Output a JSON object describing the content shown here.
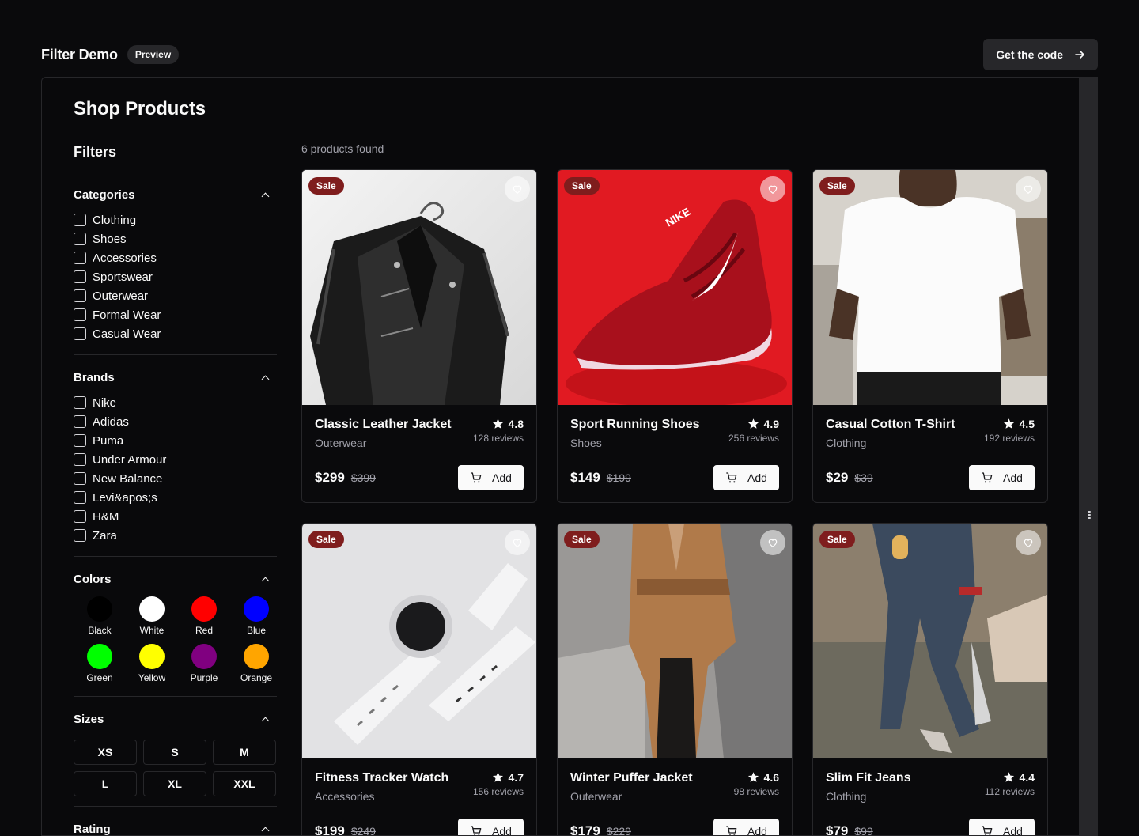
{
  "topbar": {
    "title": "Filter Demo",
    "badge": "Preview",
    "cta": "Get the code"
  },
  "page": {
    "title": "Shop Products",
    "filters_heading": "Filters",
    "count_text": "6 products found"
  },
  "filters": {
    "categories": {
      "title": "Categories",
      "items": [
        "Clothing",
        "Shoes",
        "Accessories",
        "Sportswear",
        "Outerwear",
        "Formal Wear",
        "Casual Wear"
      ]
    },
    "brands": {
      "title": "Brands",
      "items": [
        "Nike",
        "Adidas",
        "Puma",
        "Under Armour",
        "New Balance",
        "Levi&apos;s",
        "H&M",
        "Zara"
      ]
    },
    "colors": {
      "title": "Colors",
      "items": [
        {
          "label": "Black",
          "hex": "#000000"
        },
        {
          "label": "White",
          "hex": "#ffffff"
        },
        {
          "label": "Red",
          "hex": "#ff0000"
        },
        {
          "label": "Blue",
          "hex": "#0000ff"
        },
        {
          "label": "Green",
          "hex": "#00ff00"
        },
        {
          "label": "Yellow",
          "hex": "#ffff00"
        },
        {
          "label": "Purple",
          "hex": "#800080"
        },
        {
          "label": "Orange",
          "hex": "#ffa500"
        }
      ]
    },
    "sizes": {
      "title": "Sizes",
      "items": [
        "XS",
        "S",
        "M",
        "L",
        "XL",
        "XXL"
      ]
    },
    "rating": {
      "title": "Rating"
    }
  },
  "products": [
    {
      "name": "Classic Leather Jacket",
      "category": "Outerwear",
      "rating": "4.8",
      "reviews": "128 reviews",
      "price": "$299",
      "old_price": "$399",
      "badge": "Sale",
      "add": "Add"
    },
    {
      "name": "Sport Running Shoes",
      "category": "Shoes",
      "rating": "4.9",
      "reviews": "256 reviews",
      "price": "$149",
      "old_price": "$199",
      "badge": "Sale",
      "add": "Add"
    },
    {
      "name": "Casual Cotton T-Shirt",
      "category": "Clothing",
      "rating": "4.5",
      "reviews": "192 reviews",
      "price": "$29",
      "old_price": "$39",
      "badge": "Sale",
      "add": "Add"
    },
    {
      "name": "Fitness Tracker Watch",
      "category": "Accessories",
      "rating": "4.7",
      "reviews": "156 reviews",
      "price": "$199",
      "old_price": "$249",
      "badge": "Sale",
      "add": "Add"
    },
    {
      "name": "Winter Puffer Jacket",
      "category": "Outerwear",
      "rating": "4.6",
      "reviews": "98 reviews",
      "price": "$179",
      "old_price": "$229",
      "badge": "Sale",
      "add": "Add"
    },
    {
      "name": "Slim Fit Jeans",
      "category": "Clothing",
      "rating": "4.4",
      "reviews": "112 reviews",
      "price": "$79",
      "old_price": "$99",
      "badge": "Sale",
      "add": "Add"
    }
  ]
}
